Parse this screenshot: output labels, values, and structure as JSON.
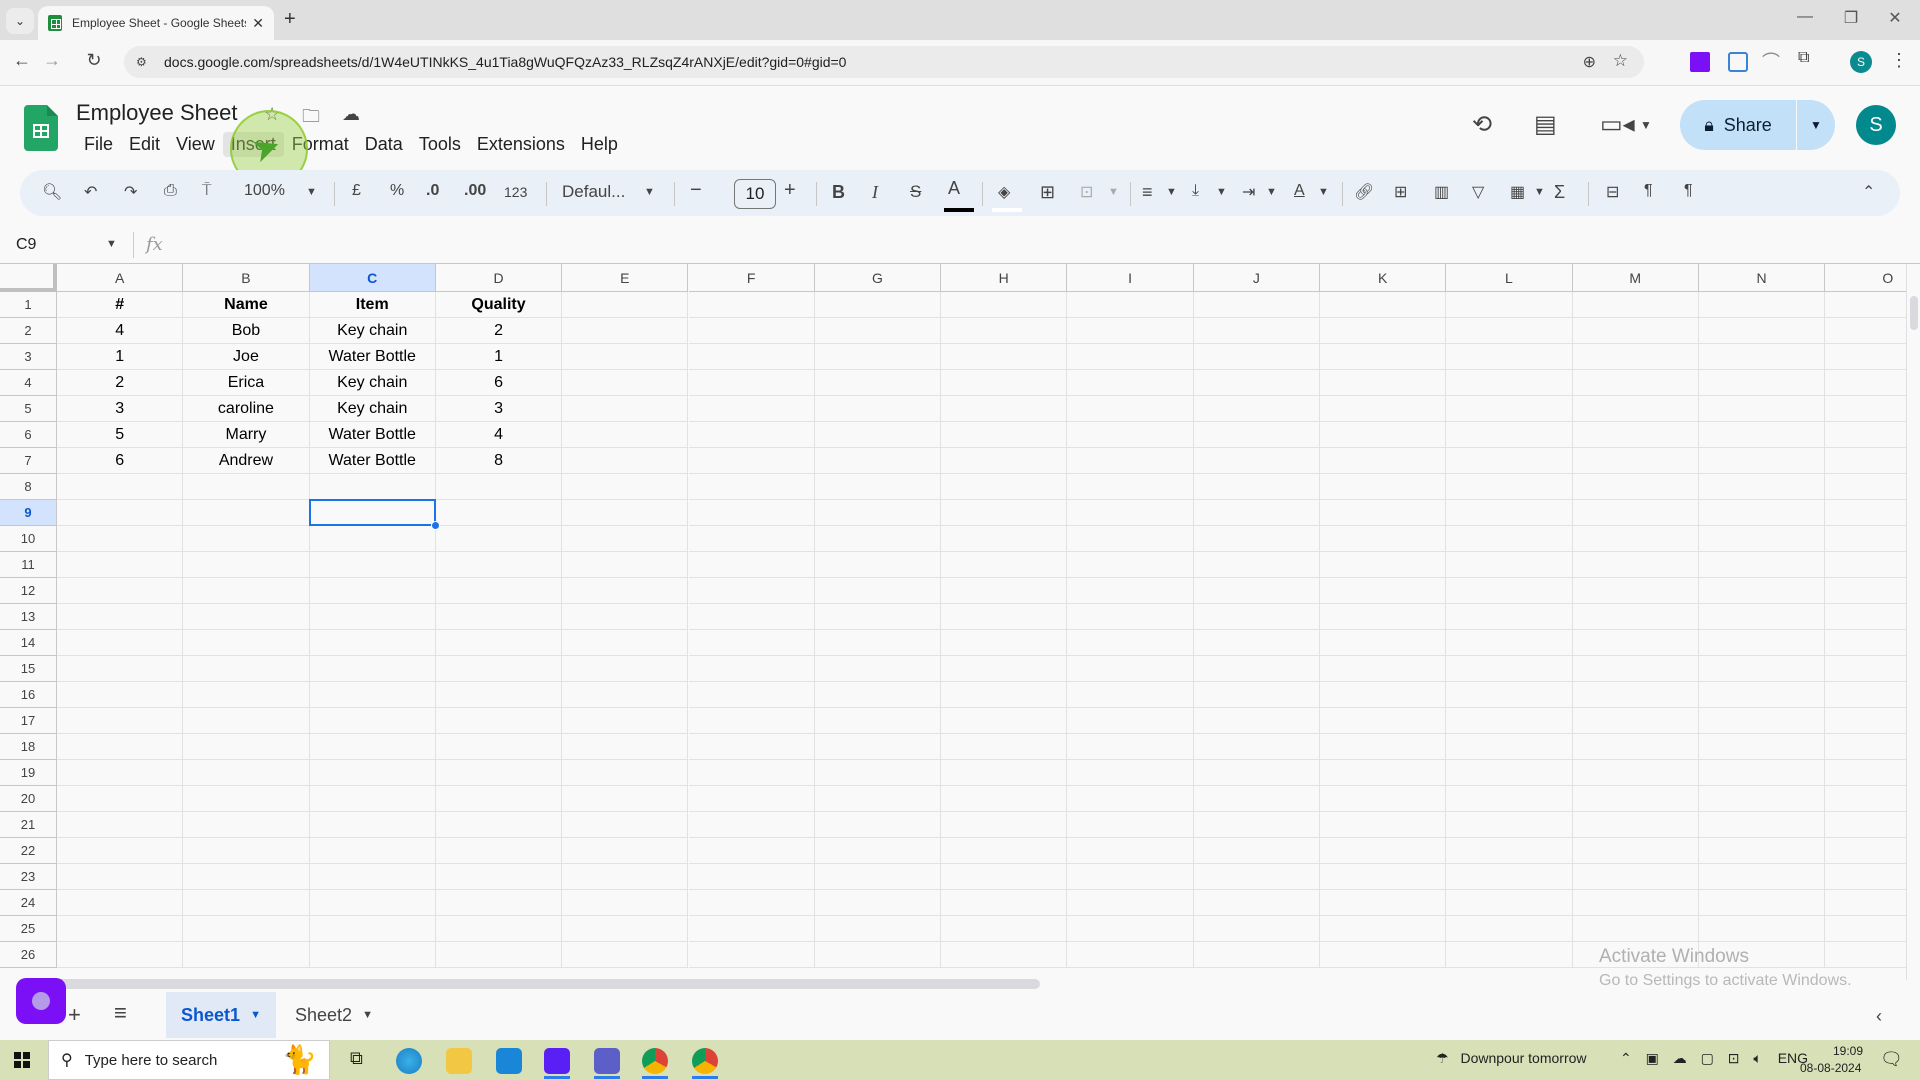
{
  "browser": {
    "tab_title": "Employee Sheet - Google Sheets",
    "url": "docs.google.com/spreadsheets/d/1W4eUTINkKS_4u1Tia8gWuQFQzAz33_RLZsqZ4rANXjE/edit?gid=0#gid=0",
    "profile_initial": "S",
    "new_tab_label": "+",
    "close_label": "✕"
  },
  "app": {
    "doc_title": "Employee Sheet",
    "menus": [
      "File",
      "Edit",
      "View",
      "Insert",
      "Format",
      "Data",
      "Tools",
      "Extensions",
      "Help"
    ],
    "hovered_menu": "Insert",
    "share_label": "Share",
    "account_initial": "S"
  },
  "toolbar": {
    "zoom": "100%",
    "currency": "£",
    "percent": "%",
    "decrease_decimal": ".0",
    "increase_decimal": ".00",
    "number_format": "123",
    "font": "Defaul...",
    "font_size": "10",
    "text_color": "#000000",
    "fill_color": "#ffffff"
  },
  "formula_bar": {
    "name_box": "C9",
    "fx_label": "fx",
    "formula": ""
  },
  "grid": {
    "columns": [
      "A",
      "B",
      "C",
      "D",
      "E",
      "F",
      "G",
      "H",
      "I",
      "J",
      "K",
      "L",
      "M",
      "N",
      "O"
    ],
    "row_numbers": [
      "1",
      "2",
      "3",
      "4",
      "5",
      "6",
      "7",
      "8",
      "9",
      "10",
      "11",
      "12",
      "13",
      "14",
      "15",
      "16",
      "17",
      "18",
      "19",
      "20",
      "21",
      "22",
      "23",
      "24",
      "25",
      "26"
    ],
    "selected_cell": "C9",
    "selected_column": "C",
    "selected_row": "9",
    "header": [
      "#",
      "Name",
      "Item",
      "Quality"
    ],
    "rows": [
      [
        "4",
        "Bob",
        "Key chain",
        "2"
      ],
      [
        "1",
        "Joe",
        "Water Bottle",
        "1"
      ],
      [
        "2",
        "Erica",
        "Key chain",
        "6"
      ],
      [
        "3",
        "caroline",
        "Key chain",
        "3"
      ],
      [
        "5",
        "Marry",
        "Water Bottle",
        "4"
      ],
      [
        "6",
        "Andrew",
        "Water Bottle",
        "8"
      ]
    ]
  },
  "sheets": {
    "tabs": [
      "Sheet1",
      "Sheet2"
    ],
    "active": "Sheet1"
  },
  "watermark": {
    "line1": "Activate Windows",
    "line2": "Go to Settings to activate Windows."
  },
  "taskbar": {
    "search_placeholder": "Type here to search",
    "weather": "Downpour tomorrow",
    "language": "ENG",
    "time": "19:09",
    "date": "08-08-2024"
  }
}
